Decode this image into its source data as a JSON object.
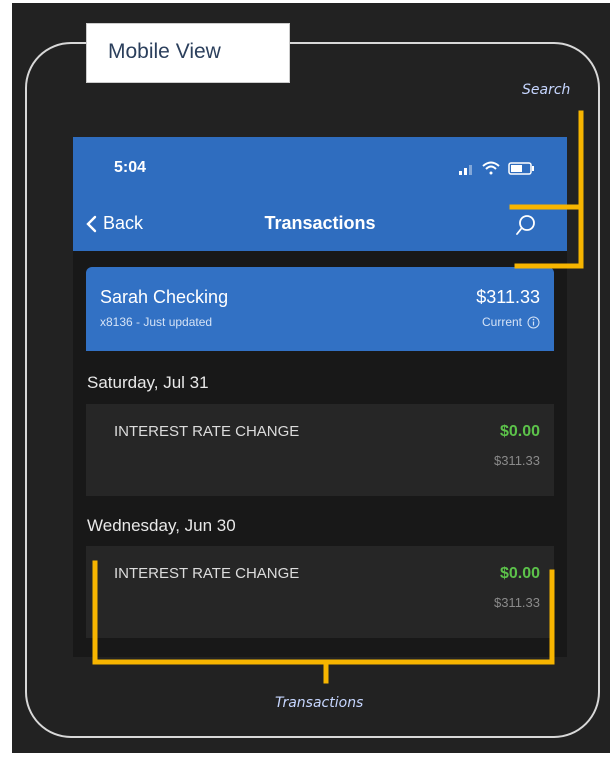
{
  "diagram": {
    "title": "Mobile View",
    "callouts": {
      "search": "Search",
      "transactions": "Transactions"
    },
    "callout_color": "#f7b500"
  },
  "status_bar": {
    "time": "5:04"
  },
  "nav": {
    "back_label": "Back",
    "title": "Transactions",
    "search_icon": "search-icon"
  },
  "account": {
    "name": "Sarah Checking",
    "subtitle": "x8136 - Just updated",
    "balance": "$311.33",
    "balance_status": "Current"
  },
  "transaction_groups": [
    {
      "date": "Saturday, Jul 31",
      "transactions": [
        {
          "description": "INTEREST RATE CHANGE",
          "amount": "$0.00",
          "running_balance": "$311.33"
        }
      ]
    },
    {
      "date": "Wednesday, Jun 30",
      "transactions": [
        {
          "description": "INTEREST RATE CHANGE",
          "amount": "$0.00",
          "running_balance": "$311.33"
        }
      ]
    }
  ],
  "colors": {
    "header_blue": "#2f6dbf",
    "card_blue": "#3271c4",
    "positive_amount": "#5cc24a",
    "background": "#181818"
  }
}
